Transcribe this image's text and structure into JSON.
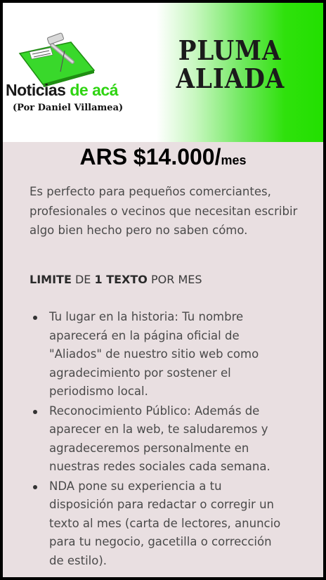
{
  "header": {
    "logo_title_part1": "Noticias",
    "logo_title_part2": "de acá",
    "logo_subtitle": "(Por Daniel Villamea)",
    "brand_line1": "PLUMA",
    "brand_line2": "ALIADA",
    "colors": {
      "gradient_end": "#22e000",
      "logo_green": "#2fd412",
      "paper_green": "#39d82b"
    }
  },
  "plan": {
    "price_main": "ARS $14.000/",
    "price_unit": "mes",
    "description": "Es perfecto para pequeños comerciantes, profesionales o vecinos que necesitan escribir algo bien hecho pero no saben cómo.",
    "limit": {
      "w1": "LIMITE",
      "w2": "DE",
      "w3": "1 TEXTO",
      "w4": "POR MES"
    },
    "benefits": [
      "Tu lugar en la historia: Tu nombre aparecerá en la página oficial de \"Aliados\" de nuestro sitio web como agradecimiento por sostener el periodismo local.",
      "Reconocimiento Público: Además de aparecer en la web, te saludaremos y agradeceremos personalmente en nuestras redes sociales cada semana.",
      "NDA pone su experiencia a tu disposición para redactar o corregir un texto al mes (carta de lectores, anuncio para tu negocio, gacetilla o corrección de estilo)."
    ],
    "colors": {
      "background": "#e9dfe1",
      "text": "#4a4a4a"
    }
  }
}
